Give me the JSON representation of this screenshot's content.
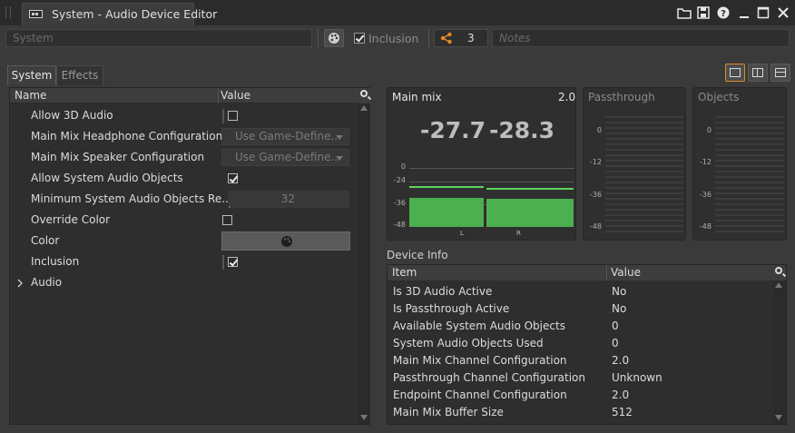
{
  "window": {
    "title": "System - Audio Device Editor",
    "buttons": [
      "folder-icon",
      "save-icon",
      "help-icon",
      "minimize-icon",
      "maximize-icon",
      "close-icon"
    ]
  },
  "toolbar": {
    "name_placeholder": "System",
    "inclusion_label": "Inclusion",
    "inclusion_checked": true,
    "share_count": "3",
    "notes_placeholder": "Notes"
  },
  "tabs": [
    {
      "label": "System",
      "active": true
    },
    {
      "label": "Effects",
      "active": false
    }
  ],
  "property_grid": {
    "headers": {
      "name": "Name",
      "value": "Value"
    },
    "rows": [
      {
        "label": "Allow 3D Audio",
        "type": "checkbox",
        "checked": false
      },
      {
        "label": "Main Mix Headphone Configuration",
        "type": "dropdown",
        "value": "Use Game-Define..."
      },
      {
        "label": "Main Mix Speaker Configuration",
        "type": "dropdown",
        "value": "Use Game-Define..."
      },
      {
        "label": "Allow System Audio Objects",
        "type": "checkbox",
        "checked": true
      },
      {
        "label": "Minimum System Audio Objects Re...",
        "type": "number",
        "value": "32"
      },
      {
        "label": "Override Color",
        "type": "checkbox",
        "checked": false
      },
      {
        "label": "Color",
        "type": "color"
      },
      {
        "label": "Inclusion",
        "type": "checkbox",
        "checked": true
      },
      {
        "label": "Audio",
        "type": "group"
      }
    ]
  },
  "meters": {
    "main_mix": {
      "title": "Main mix",
      "channel_config": "2.0",
      "values": [
        "-27.7",
        "-28.3"
      ],
      "ticks": [
        "0",
        "-24",
        "-36",
        "-48"
      ],
      "channels": [
        "L",
        "R"
      ],
      "levels_db": [
        -28.5,
        -28.7
      ],
      "peaks_db": [
        -26.5,
        -27.0
      ]
    },
    "passthrough": {
      "title": "Passthrough",
      "ticks": [
        "0",
        "-12",
        "-36",
        "-48"
      ]
    },
    "objects": {
      "title": "Objects",
      "ticks": [
        "0",
        "-12",
        "-36",
        "-48"
      ]
    }
  },
  "device_info": {
    "title": "Device Info",
    "headers": {
      "item": "Item",
      "value": "Value"
    },
    "rows": [
      {
        "item": "Is 3D Audio Active",
        "value": "No"
      },
      {
        "item": "Is Passthrough Active",
        "value": "No"
      },
      {
        "item": "Available System Audio Objects",
        "value": "0"
      },
      {
        "item": "System Audio Objects Used",
        "value": "0"
      },
      {
        "item": "Main Mix Channel Configuration",
        "value": "2.0"
      },
      {
        "item": "Passthrough Channel Configuration",
        "value": "Unknown"
      },
      {
        "item": "Endpoint Channel Configuration",
        "value": "2.0"
      },
      {
        "item": "Main Mix Buffer Size",
        "value": "512"
      }
    ]
  },
  "colors": {
    "accent": "#e08a2a",
    "meter_green": "#4caf50",
    "background": "#3a3a3a"
  }
}
